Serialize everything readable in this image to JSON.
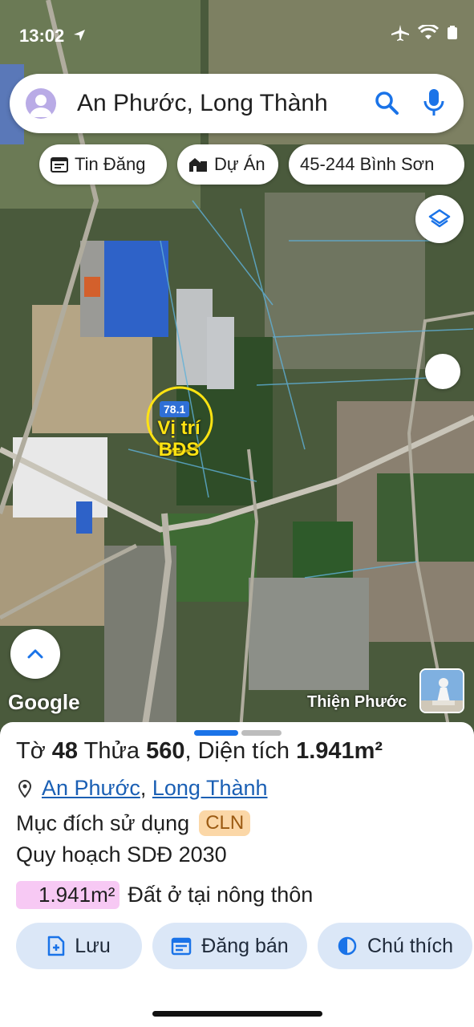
{
  "status_bar": {
    "time": "13:02"
  },
  "search": {
    "text": "An Phước, Long Thành"
  },
  "chips": [
    {
      "label": "Tin Đăng",
      "icon": "calendar-icon"
    },
    {
      "label": "Dự Án",
      "icon": "buildings-icon"
    },
    {
      "label": "45-244 Bình Sơn"
    }
  ],
  "map": {
    "marker_number": "78.1",
    "marker_label_line1": "Vị trí",
    "marker_label_line2": "BĐS",
    "attribution": "Google",
    "place_label": "Thiện Phước"
  },
  "sheet": {
    "title_prefix": "Tờ",
    "sheet_number": "48",
    "parcel_label": "Thửa",
    "parcel_number": "560",
    "area_label": ", Diện tích",
    "area_value": "1.941m²",
    "location_1": "An Phước",
    "location_separator": ",",
    "location_2": "Long Thành",
    "purpose_label": "Mục đích sử dụng",
    "purpose_code": "CLN",
    "plan_label": "Quy hoạch SDĐ 2030",
    "plan_area": "1.941m²",
    "plan_type": "Đất ở tại nông thôn"
  },
  "actions": {
    "save_label": "Lưu",
    "sell_label": "Đăng bán",
    "legend_label": "Chú thích"
  },
  "colors": {
    "accent": "#1a73e8",
    "marker_ring": "#ffe312",
    "cln_badge": "#fbd7a7",
    "area_badge": "#f7c9f4",
    "action_bg": "#dbe7f7"
  }
}
